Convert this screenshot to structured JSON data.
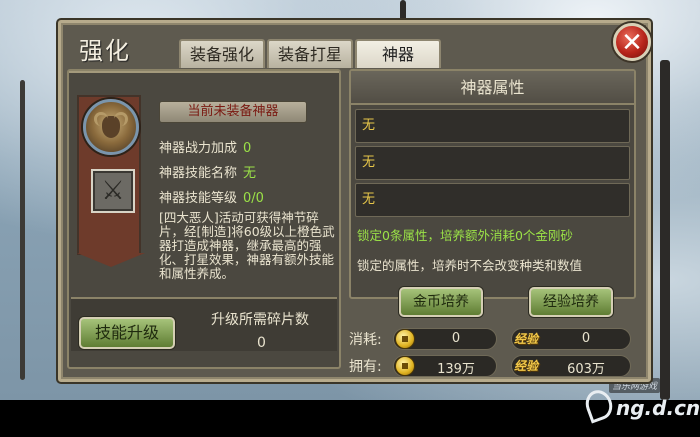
{
  "window": {
    "title": "强化",
    "tabs": [
      {
        "label": "装备强化",
        "active": false
      },
      {
        "label": "装备打星",
        "active": false
      },
      {
        "label": "神器",
        "active": true
      }
    ],
    "close_label": "✕"
  },
  "left": {
    "banner": "当前未装备神器",
    "stats": [
      {
        "label": "神器战力加成",
        "value": "0"
      },
      {
        "label": "神器技能名称",
        "value": "无"
      },
      {
        "label": "神器技能等级",
        "value": "0/0"
      }
    ],
    "description": "[四大恶人]活动可获得神节碎片，经[制造]将60级以上橙色武器打造成神器，继承最高的强化、打星效果，神器有额外技能和属性养成。",
    "help_label": "?",
    "skill_button": "技能升级",
    "fragments_label": "升级所需碎片数",
    "fragments_value": "0"
  },
  "right": {
    "title": "神器属性",
    "attributes": [
      "无",
      "无",
      "无"
    ],
    "lock_note": "锁定0条属性，培养额外消耗0个金刚砂",
    "lock_tip": "锁定的属性，培养时不会改变种类和数值",
    "gold_button": "金币培养",
    "exp_button": "经验培养"
  },
  "resources": {
    "cost_label": "消耗:",
    "own_label": "拥有:",
    "exp_badge": "经验",
    "cost_gold": "0",
    "cost_exp": "0",
    "own_gold": "139万",
    "own_exp": "603万"
  },
  "watermark": {
    "small": "当乐网游戏",
    "text": "ng.d.cn"
  },
  "colors": {
    "accent_green": "#9be247",
    "attribute_yellow": "#e9c84a",
    "close_red": "#b7241a"
  }
}
